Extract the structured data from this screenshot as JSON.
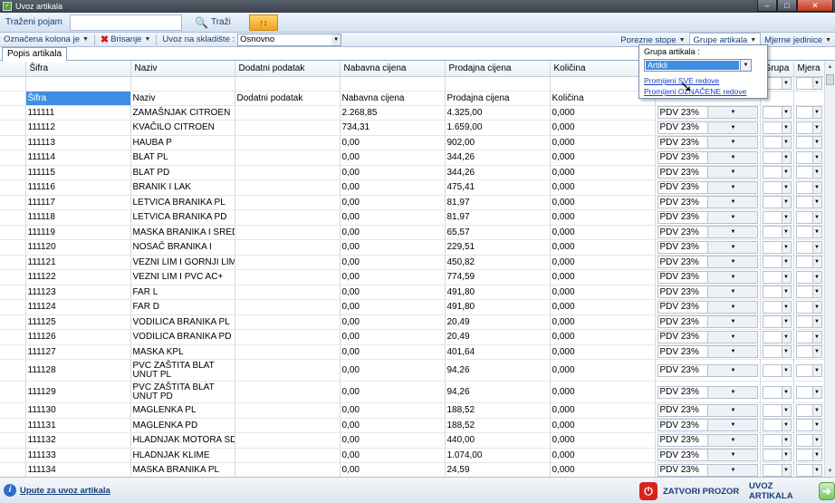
{
  "window": {
    "title": "Uvoz artikala",
    "minimize": "‒",
    "maximize": "□",
    "close": "✕"
  },
  "toolbar1": {
    "search_label": "Traženi pojam",
    "search_value": "",
    "search_button": "Traži",
    "sort_label": "↑↕"
  },
  "toolbar2": {
    "marked_column": "Označena kolona je",
    "delete": "Brisanje",
    "warehouse_label": "Uvoz na skladište :",
    "warehouse_value": "Osnovno",
    "tax_rates": "Porezne stope",
    "item_groups": "Grupe artikala",
    "units": "Mjerne jedinice"
  },
  "tab": {
    "label": "Popis artikala"
  },
  "columns": [
    "Šifra",
    "Naziv",
    "Dodatni podatak",
    "Nabavna cijena",
    "Prodajna cijena",
    "Količina",
    "",
    "Grupa",
    "Mjera"
  ],
  "field_row": [
    "Šifra",
    "Naziv",
    "Dodatni podatak",
    "Nabavna cijena",
    "Prodajna cijena",
    "Količina"
  ],
  "rows": [
    {
      "sifra": "111111",
      "naziv": "ZAMAŠNJAK CITROEN",
      "dodatni": "",
      "nabavna": "2.268,85",
      "prodajna": "4.325,00",
      "kolicina": "0,000",
      "porez": "PDV 23%"
    },
    {
      "sifra": "111112",
      "naziv": "KVAČILO CITROEN",
      "dodatni": "",
      "nabavna": "734,31",
      "prodajna": "1.659,00",
      "kolicina": "0,000",
      "porez": "PDV 23%"
    },
    {
      "sifra": "111113",
      "naziv": "HAUBA P",
      "dodatni": "",
      "nabavna": "0,00",
      "prodajna": "902,00",
      "kolicina": "0,000",
      "porez": "PDV 23%"
    },
    {
      "sifra": "111114",
      "naziv": "BLAT PL",
      "dodatni": "",
      "nabavna": "0,00",
      "prodajna": "344,26",
      "kolicina": "0,000",
      "porez": "PDV 23%"
    },
    {
      "sifra": "111115",
      "naziv": "BLAT PD",
      "dodatni": "",
      "nabavna": "0,00",
      "prodajna": "344,26",
      "kolicina": "0,000",
      "porez": "PDV 23%"
    },
    {
      "sifra": "111116",
      "naziv": "BRANIK I LAK",
      "dodatni": "",
      "nabavna": "0,00",
      "prodajna": "475,41",
      "kolicina": "0,000",
      "porez": "PDV 23%"
    },
    {
      "sifra": "111117",
      "naziv": "LETVICA BRANIKA PL",
      "dodatni": "",
      "nabavna": "0,00",
      "prodajna": "81,97",
      "kolicina": "0,000",
      "porez": "PDV 23%"
    },
    {
      "sifra": "111118",
      "naziv": "LETVICA BRANIKA PD",
      "dodatni": "",
      "nabavna": "0,00",
      "prodajna": "81,97",
      "kolicina": "0,000",
      "porez": "PDV 23%"
    },
    {
      "sifra": "111119",
      "naziv": "MASKA BRANIKA I SRED",
      "dodatni": "",
      "nabavna": "0,00",
      "prodajna": "65,57",
      "kolicina": "0,000",
      "porez": "PDV 23%"
    },
    {
      "sifra": "111120",
      "naziv": "NOSAČ BRANIKA I",
      "dodatni": "",
      "nabavna": "0,00",
      "prodajna": "229,51",
      "kolicina": "0,000",
      "porez": "PDV 23%"
    },
    {
      "sifra": "111121",
      "naziv": "VEZNI LIM I GORNJI LIM",
      "dodatni": "",
      "nabavna": "0,00",
      "prodajna": "450,82",
      "kolicina": "0,000",
      "porez": "PDV 23%"
    },
    {
      "sifra": "111122",
      "naziv": "VEZNI LIM I PVC AC+",
      "dodatni": "",
      "nabavna": "0,00",
      "prodajna": "774,59",
      "kolicina": "0,000",
      "porez": "PDV 23%"
    },
    {
      "sifra": "111123",
      "naziv": "FAR L",
      "dodatni": "",
      "nabavna": "0,00",
      "prodajna": "491,80",
      "kolicina": "0,000",
      "porez": "PDV 23%"
    },
    {
      "sifra": "111124",
      "naziv": "FAR D",
      "dodatni": "",
      "nabavna": "0,00",
      "prodajna": "491,80",
      "kolicina": "0,000",
      "porez": "PDV 23%"
    },
    {
      "sifra": "111125",
      "naziv": "VODILICA BRANIKA PL",
      "dodatni": "",
      "nabavna": "0,00",
      "prodajna": "20,49",
      "kolicina": "0,000",
      "porez": "PDV 23%"
    },
    {
      "sifra": "111126",
      "naziv": "VODILICA BRANIKA PD",
      "dodatni": "",
      "nabavna": "0,00",
      "prodajna": "20,49",
      "kolicina": "0,000",
      "porez": "PDV 23%"
    },
    {
      "sifra": "111127",
      "naziv": "MASKA KPL",
      "dodatni": "",
      "nabavna": "0,00",
      "prodajna": "401,64",
      "kolicina": "0,000",
      "porez": "PDV 23%"
    },
    {
      "sifra": "111128",
      "naziv": "PVC ZAŠTITA BLAT UNUT PL",
      "dodatni": "",
      "nabavna": "0,00",
      "prodajna": "94,26",
      "kolicina": "0,000",
      "porez": "PDV 23%",
      "tall": true
    },
    {
      "sifra": "111129",
      "naziv": "PVC ZAŠTITA BLAT UNUT PD",
      "dodatni": "",
      "nabavna": "0,00",
      "prodajna": "94,26",
      "kolicina": "0,000",
      "porez": "PDV 23%",
      "tall": true
    },
    {
      "sifra": "111130",
      "naziv": "MAGLENKA PL",
      "dodatni": "",
      "nabavna": "0,00",
      "prodajna": "188,52",
      "kolicina": "0,000",
      "porez": "PDV 23%"
    },
    {
      "sifra": "111131",
      "naziv": "MAGLENKA PD",
      "dodatni": "",
      "nabavna": "0,00",
      "prodajna": "188,52",
      "kolicina": "0,000",
      "porez": "PDV 23%"
    },
    {
      "sifra": "111132",
      "naziv": "HLADNJAK MOTORA SDI",
      "dodatni": "",
      "nabavna": "0,00",
      "prodajna": "440,00",
      "kolicina": "0,000",
      "porez": "PDV 23%"
    },
    {
      "sifra": "111133",
      "naziv": "HLADNJAK KLIME",
      "dodatni": "",
      "nabavna": "0,00",
      "prodajna": "1.074,00",
      "kolicina": "0,000",
      "porez": "PDV 23%"
    },
    {
      "sifra": "111134",
      "naziv": "MASKA BRANIKA PL",
      "dodatni": "",
      "nabavna": "0,00",
      "prodajna": "24,59",
      "kolicina": "0,000",
      "porez": "PDV 23%"
    }
  ],
  "popup": {
    "label": "Grupa artikala :",
    "value": "Artikli",
    "link_all": "Promijeni SVE redove",
    "link_marked": "Promijeni OZNAČENE redove"
  },
  "bottom": {
    "help": "Upute za uvoz artikala",
    "close": "ZATVORI PROZOR",
    "import": "UVOZ ARTIKALA"
  },
  "colors": {
    "accent": "#3d8fe6",
    "toolbar_text": "#16407a",
    "close_red": "#d4241c",
    "import_green": "#7bc468"
  }
}
